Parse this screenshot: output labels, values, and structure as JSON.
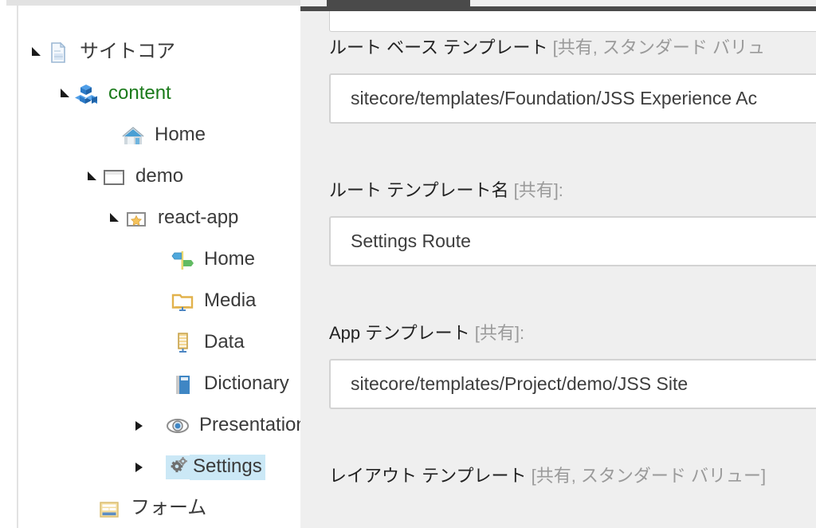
{
  "colors": {
    "panel_bg": "#efefef",
    "tree_bg": "#ffffff",
    "selection": "#cbe8f6",
    "label_text": "#222222",
    "qualifier_text": "#9a9a9a",
    "green_node": "#1b7a1b",
    "input_border": "#d3d3d3",
    "scrollbar_thumb": "#4a4a4a"
  },
  "tree": {
    "name": "content-tree",
    "items": [
      {
        "label": "サイトコア",
        "icon": "document-icon",
        "state": "open",
        "indent": 0,
        "selected": false,
        "green": false,
        "truncated": false
      },
      {
        "label": "content",
        "icon": "cubes-icon",
        "state": "open",
        "indent": 1,
        "selected": false,
        "green": true,
        "truncated": false
      },
      {
        "label": "Home",
        "icon": "home-icon",
        "state": "none",
        "indent": 2,
        "selected": false,
        "green": false,
        "truncated": false
      },
      {
        "label": "demo",
        "icon": "site-window-icon",
        "state": "open",
        "indent": 2,
        "selected": false,
        "green": false,
        "truncated": false
      },
      {
        "label": "react-app",
        "icon": "star-app-icon",
        "state": "open",
        "indent": 3,
        "selected": false,
        "green": false,
        "truncated": false
      },
      {
        "label": "Home",
        "icon": "signpost-icon",
        "state": "none",
        "indent": 4,
        "selected": false,
        "green": false,
        "truncated": false
      },
      {
        "label": "Media",
        "icon": "media-folder-icon",
        "state": "none",
        "indent": 4,
        "selected": false,
        "green": false,
        "truncated": false
      },
      {
        "label": "Data",
        "icon": "data-icon",
        "state": "none",
        "indent": 4,
        "selected": false,
        "green": false,
        "truncated": false
      },
      {
        "label": "Dictionary",
        "icon": "book-icon",
        "state": "none",
        "indent": 4,
        "selected": false,
        "green": false,
        "truncated": false
      },
      {
        "label": "Presentation",
        "icon": "eye-icon",
        "state": "closed",
        "indent": 4,
        "selected": false,
        "green": false,
        "truncated": true
      },
      {
        "label": "Settings",
        "icon": "gears-icon",
        "state": "closed",
        "indent": 4,
        "selected": true,
        "green": false,
        "truncated": false
      },
      {
        "label": "フォーム",
        "icon": "forms-icon",
        "state": "none",
        "indent": 1,
        "selected": false,
        "green": false,
        "truncated": false
      }
    ]
  },
  "editor": {
    "name": "field-editor",
    "scrollbar": {
      "orientation": "horizontal",
      "thumb_visible": true
    },
    "fields": [
      {
        "label_main": "ルート ベース テンプレート ",
        "label_qualifier": "[共有, スタンダード バリュ",
        "value": "sitecore/templates/Foundation/JSS Experience Ac",
        "placeholder": ""
      },
      {
        "label_main": "ルート テンプレート名 ",
        "label_qualifier": "[共有]:",
        "value": "Settings Route",
        "placeholder": ""
      },
      {
        "label_main": "App テンプレート ",
        "label_qualifier": "[共有]:",
        "value": "sitecore/templates/Project/demo/JSS Site",
        "placeholder": ""
      },
      {
        "label_main": "レイアウト テンプレート ",
        "label_qualifier": "[共有, スタンダード バリュー]",
        "value": "",
        "placeholder": ""
      }
    ]
  }
}
